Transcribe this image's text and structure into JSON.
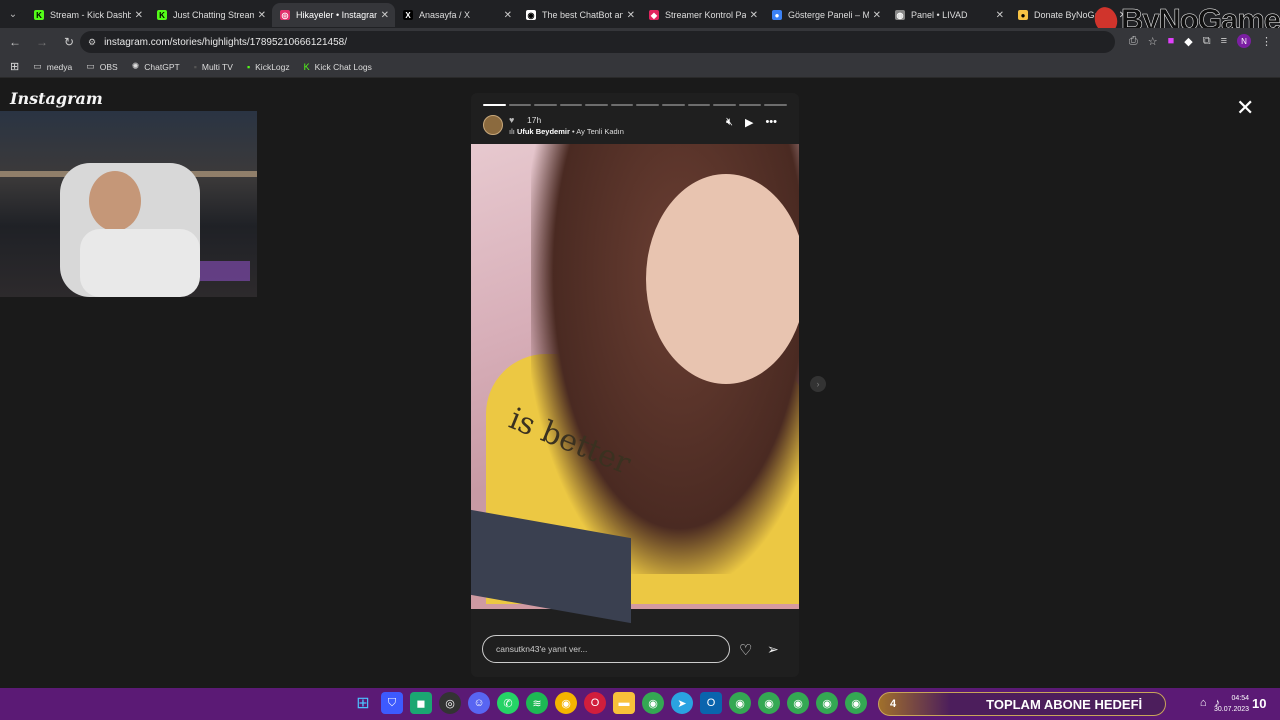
{
  "browser": {
    "tabs": [
      {
        "title": "Stream - Kick Dashboard",
        "favicon": "kick-icon",
        "color": "#53fc18",
        "glyph": "K"
      },
      {
        "title": "Just Chatting Stream",
        "favicon": "kick-icon",
        "color": "#53fc18",
        "glyph": "K"
      },
      {
        "title": "Hikayeler • Instagram",
        "favicon": "instagram-icon",
        "color": "#e1306c",
        "glyph": "◎",
        "active": true
      },
      {
        "title": "Anasayfa / X",
        "favicon": "x-icon",
        "color": "#000000",
        "glyph": "X"
      },
      {
        "title": "The best ChatBot and",
        "favicon": "chatbot-icon",
        "color": "#ffffff",
        "glyph": "◉"
      },
      {
        "title": "Streamer Kontrol Pan",
        "favicon": "gamepad-icon",
        "color": "#e0245e",
        "glyph": "◆"
      },
      {
        "title": "Gösterge Paneli – Mi",
        "favicon": "dashboard-icon",
        "color": "#3b82f6",
        "glyph": "●"
      },
      {
        "title": "Panel • LIVAD",
        "favicon": "livad-icon",
        "color": "#888888",
        "glyph": "◍"
      },
      {
        "title": "Donate ByNoGame",
        "favicon": "bynogame-icon",
        "color": "#f6c244",
        "glyph": "●"
      }
    ],
    "url": "instagram.com/stories/highlights/17895210666121458/",
    "bookmarks": [
      {
        "label": "medya",
        "icon": "folder-icon"
      },
      {
        "label": "OBS",
        "icon": "folder-icon"
      },
      {
        "label": "ChatGPT",
        "icon": "chatgpt-icon"
      },
      {
        "label": "Multi TV",
        "icon": "multitv-icon"
      },
      {
        "label": "KickLogz",
        "icon": "kicklogz-icon"
      },
      {
        "label": "Kick Chat Logs",
        "icon": "kick-icon"
      }
    ]
  },
  "overlay": {
    "brand": "ByNoGame"
  },
  "instagram": {
    "logo": "Instagram",
    "story": {
      "time": "17h",
      "music_user": "Ufuk Beydemir",
      "music_song": " • Ay Tenli Kadın",
      "shirt_text": "is better",
      "segments_total": 12,
      "segments_done": 1,
      "reply_placeholder": "cansutkn43'e yanıt ver..."
    }
  },
  "taskbar": {
    "sub_goal_count": "4",
    "sub_goal_label": "TOPLAM ABONE HEDEFİ",
    "clock_time": "04:54",
    "clock_date": "30.07.2023",
    "notification_count": "10"
  }
}
